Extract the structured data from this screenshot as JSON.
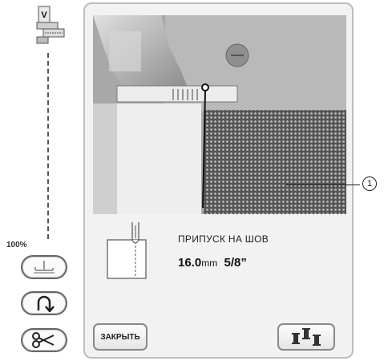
{
  "sidebar": {
    "zoom_label": "100%",
    "foot_letter": "V",
    "buttons": [
      {
        "icon": "presser-foot-lift-icon"
      },
      {
        "icon": "u-turn-icon"
      },
      {
        "icon": "scissors-icon"
      }
    ]
  },
  "panel": {
    "seam_allowance_title": "ПРИПУСК НА ШОВ",
    "seam_value_mm": "16.0",
    "seam_unit_mm": "mm",
    "seam_value_inch": "5/8”",
    "close_label": "ЗАКРЫТЬ",
    "thread_button_icon": "spools-icon"
  },
  "callout": {
    "label": "1"
  },
  "colors": {
    "panel_bg": "#f2f2f2",
    "callout_line": "#3a7bd5"
  }
}
